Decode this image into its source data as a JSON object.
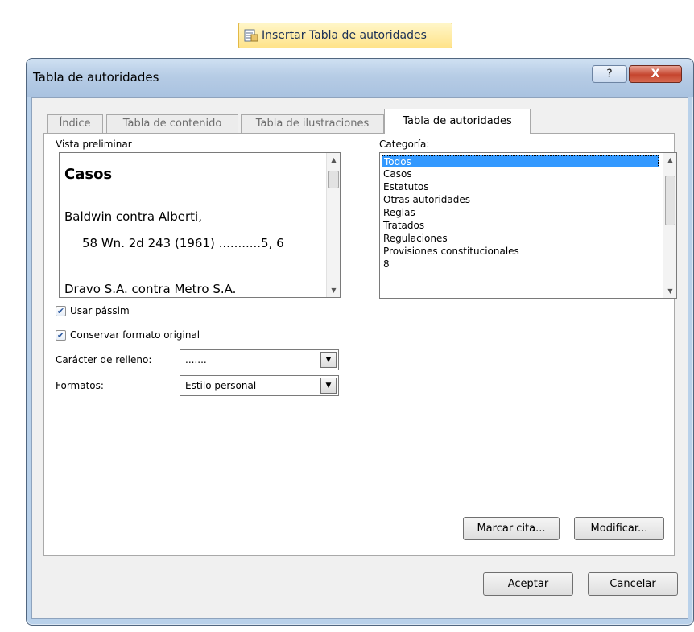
{
  "ribbon": {
    "insert_label": "Insertar Tabla de autoridades"
  },
  "dialog": {
    "title": "Tabla de autoridades",
    "help_glyph": "?",
    "close_glyph": "X"
  },
  "tabs": [
    {
      "label": "Índice"
    },
    {
      "label": "Tabla de contenido"
    },
    {
      "label": "Tabla de ilustraciones"
    },
    {
      "label": "Tabla de autoridades"
    }
  ],
  "preview": {
    "label": "Vista preliminar",
    "heading": "Casos",
    "line1": "Baldwin contra Alberti,",
    "line2": "58 Wn. 2d 243 (1961) ...........5, 6",
    "line3": "Dravo S.A. contra Metro S.A."
  },
  "category": {
    "label": "Categoría:",
    "items": [
      "Todos",
      "Casos",
      "Estatutos",
      "Otras autoridades",
      "Reglas",
      "Tratados",
      "Regulaciones",
      "Provisiones constitucionales",
      "8"
    ],
    "selected": "Todos"
  },
  "options": {
    "use_passim": {
      "label": "Usar pássim",
      "checked": true
    },
    "keep_format": {
      "label": "Conservar formato original",
      "checked": true
    },
    "fill_char_label": "Carácter de relleno:",
    "fill_char_value": ".......",
    "formats_label": "Formatos:",
    "formats_value": "Estilo personal"
  },
  "buttons": {
    "mark_citation": "Marcar cita...",
    "modify": "Modificar...",
    "ok": "Aceptar",
    "cancel": "Cancelar"
  },
  "icons": {
    "ribbon": "insert-table-of-authorities-icon",
    "check": "check-icon",
    "dropdown": "chevron-down-icon",
    "scroll_up": "scroll-up-arrow-icon",
    "scroll_down": "scroll-down-arrow-icon"
  }
}
